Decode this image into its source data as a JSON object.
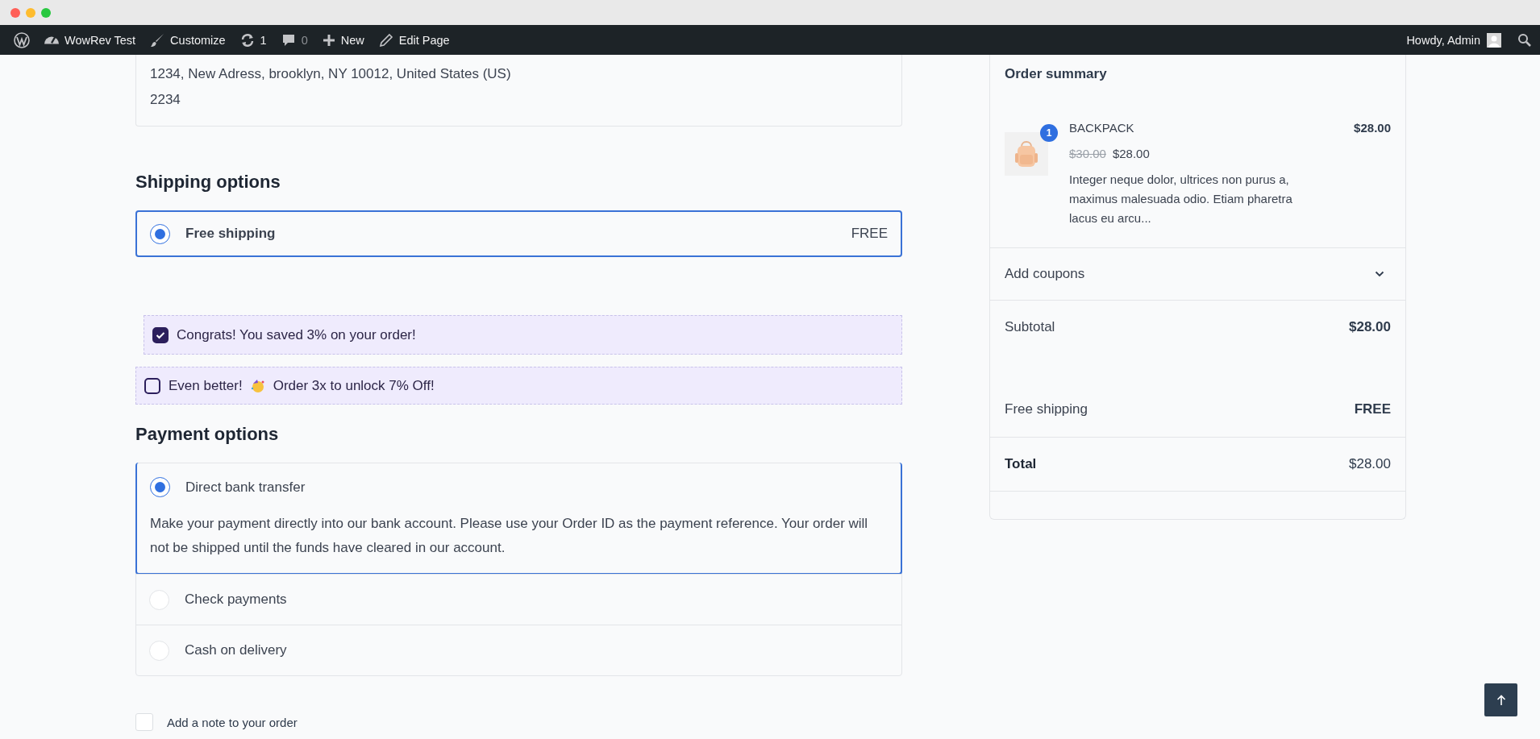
{
  "admin_bar": {
    "items": [
      {
        "kind": "wordpress"
      },
      {
        "kind": "dashboard",
        "label": "WowRev Test"
      },
      {
        "kind": "brush",
        "label": "Customize"
      },
      {
        "kind": "updates",
        "label": "1"
      },
      {
        "kind": "comments",
        "label": "0",
        "disabled": true
      },
      {
        "kind": "plus",
        "label": "New"
      },
      {
        "kind": "pencil",
        "label": "Edit Page"
      }
    ],
    "greeting": "Howdy, Admin"
  },
  "address": {
    "lines": [
      "1234, New Adress, brooklyn, NY 10012, United States (US)",
      "2234"
    ]
  },
  "shipping": {
    "title": "Shipping options",
    "options": [
      {
        "label": "Free shipping",
        "price": "FREE",
        "selected": true
      }
    ]
  },
  "offers": [
    {
      "text": "Congrats! You saved 3% on your order!",
      "checked": true
    },
    {
      "text": "Even better!",
      "emoji": true,
      "text_after": "Order 3x to unlock 7% Off!",
      "checked": false
    }
  ],
  "payment": {
    "title": "Payment options",
    "methods": [
      {
        "label": "Direct bank transfer",
        "selected": true,
        "description": "Make your payment directly into our bank account. Please use your Order ID as the payment reference. Your order will not be shipped until the funds have cleared in our account."
      },
      {
        "label": "Check payments",
        "selected": false
      },
      {
        "label": "Cash on delivery",
        "selected": false
      }
    ]
  },
  "note": {
    "label": "Add a note to your order",
    "checked": false
  },
  "summary": {
    "title": "Order summary",
    "items": [
      {
        "kind": "picture",
        "quantity": "1",
        "name": "BACKPACK",
        "total": "$28.00",
        "regular_price": "$30.00",
        "sale_price": "$28.00",
        "description": "Integer neque dolor, ultrices non purus a, maximus malesuada odio. Etiam pharetra lacus eu arcu..."
      }
    ],
    "coupons": {
      "label": "Add coupons",
      "expanded": false
    },
    "totals": [
      {
        "label": "Subtotal",
        "value": "$28.00",
        "kind": "subtotal"
      },
      {
        "label": "Free shipping",
        "value": "FREE",
        "kind": "shipping"
      },
      {
        "label": "Total",
        "value": "$28.00",
        "kind": "total"
      }
    ]
  }
}
